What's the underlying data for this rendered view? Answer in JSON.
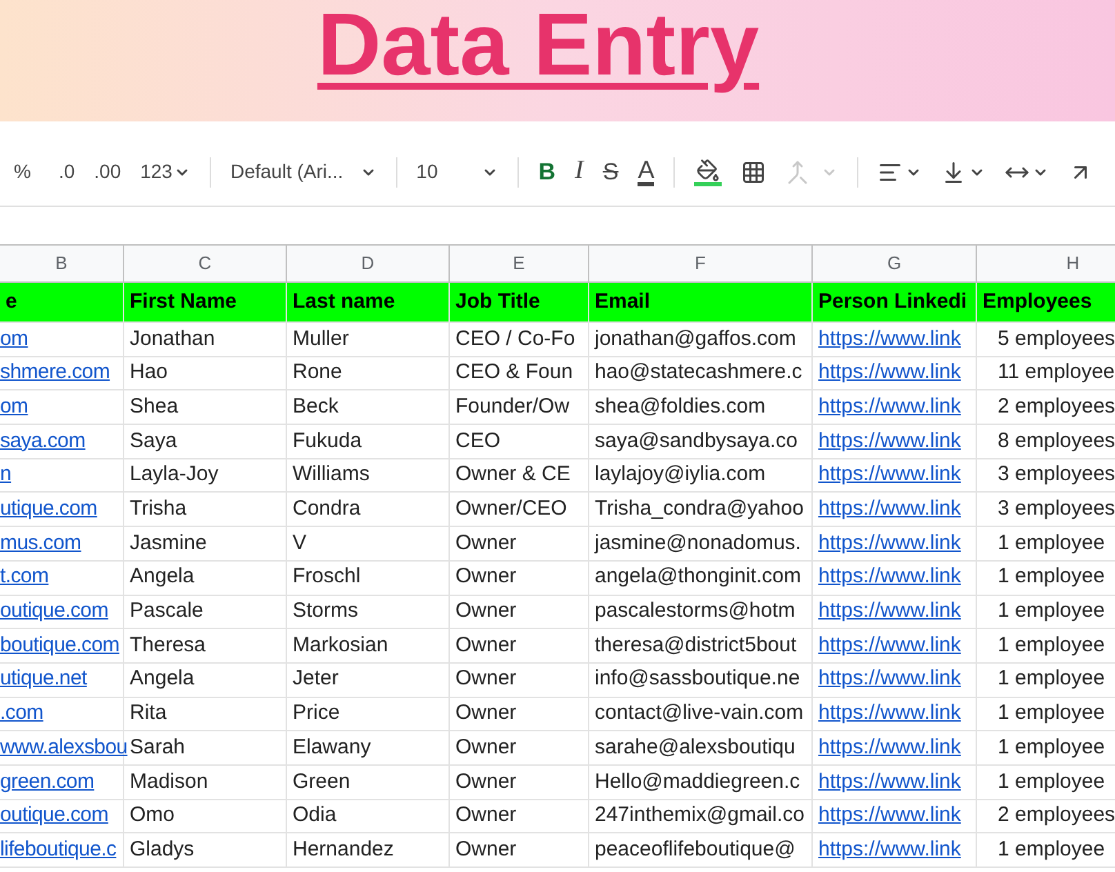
{
  "banner": {
    "title": "Data Entry"
  },
  "toolbar": {
    "percent": "%",
    "decrease_decimal": ".0",
    "increase_decimal": ".00",
    "number_format": "123",
    "font": "Default (Ari...",
    "font_size": "10",
    "bold": "B",
    "italic": "I",
    "strikethrough": "S",
    "text_color": "A",
    "merge_disabled": true
  },
  "table": {
    "columns": [
      {
        "letter": "B",
        "kind": "link"
      },
      {
        "letter": "C",
        "kind": "text"
      },
      {
        "letter": "D",
        "kind": "text"
      },
      {
        "letter": "E",
        "kind": "text"
      },
      {
        "letter": "F",
        "kind": "text"
      },
      {
        "letter": "G",
        "kind": "link"
      },
      {
        "letter": "H",
        "kind": "count"
      }
    ],
    "header_row": [
      "e",
      "First Name",
      "Last name",
      "Job Title",
      "Email",
      "Person Linkedi",
      "Employees"
    ],
    "rows": [
      [
        "om",
        "Jonathan",
        "Muller",
        "CEO / Co-Fo",
        "jonathan@gaffos.com",
        "https://www.link",
        "5 employees"
      ],
      [
        "shmere.com",
        "Hao",
        "Rone",
        "CEO & Foun",
        "hao@statecashmere.c",
        "https://www.link",
        "11 employee"
      ],
      [
        "om",
        "Shea",
        "Beck",
        "Founder/Ow",
        "shea@foldies.com",
        "https://www.link",
        "2 employees"
      ],
      [
        "saya.com",
        "Saya",
        "Fukuda",
        "CEO",
        "saya@sandbysaya.co",
        "https://www.link",
        "8 employees"
      ],
      [
        "n",
        "Layla-Joy",
        "Williams",
        "Owner & CE",
        "laylajoy@iylia.com",
        "https://www.link",
        "3 employees"
      ],
      [
        "utique.com",
        "Trisha",
        "Condra",
        "Owner/CEO",
        "Trisha_condra@yahoo",
        "https://www.link",
        "3 employees"
      ],
      [
        "mus.com",
        "Jasmine",
        "V",
        "Owner",
        "jasmine@nonadomus.",
        "https://www.link",
        "1 employee"
      ],
      [
        "t.com",
        "Angela",
        "Froschl",
        "Owner",
        "angela@thonginit.com",
        "https://www.link",
        "1 employee"
      ],
      [
        "outique.com",
        "Pascale",
        "Storms",
        "Owner",
        "pascalestorms@hotm",
        "https://www.link",
        "1 employee"
      ],
      [
        "boutique.com",
        "Theresa",
        "Markosian",
        "Owner",
        "theresa@district5bout",
        "https://www.link",
        "1 employee"
      ],
      [
        "utique.net",
        "Angela",
        "Jeter",
        "Owner",
        "info@sassboutique.ne",
        "https://www.link",
        "1 employee"
      ],
      [
        ".com",
        "Rita",
        "Price",
        "Owner",
        "contact@live-vain.com",
        "https://www.link",
        "1 employee"
      ],
      [
        "www.alexsbou",
        "Sarah",
        "Elawany",
        "Owner",
        "sarahe@alexsboutiqu",
        "https://www.link",
        "1 employee"
      ],
      [
        "green.com",
        "Madison",
        "Green",
        "Owner",
        "Hello@maddiegreen.c",
        "https://www.link",
        "1 employee"
      ],
      [
        "outique.com",
        "Omo",
        "Odia",
        "Owner",
        "247inthemix@gmail.co",
        "https://www.link",
        "2 employees"
      ],
      [
        "lifeboutique.c",
        "Gladys",
        "Hernandez",
        "Owner",
        "peaceoflifeboutique@",
        "https://www.link",
        "1 employee"
      ]
    ]
  }
}
